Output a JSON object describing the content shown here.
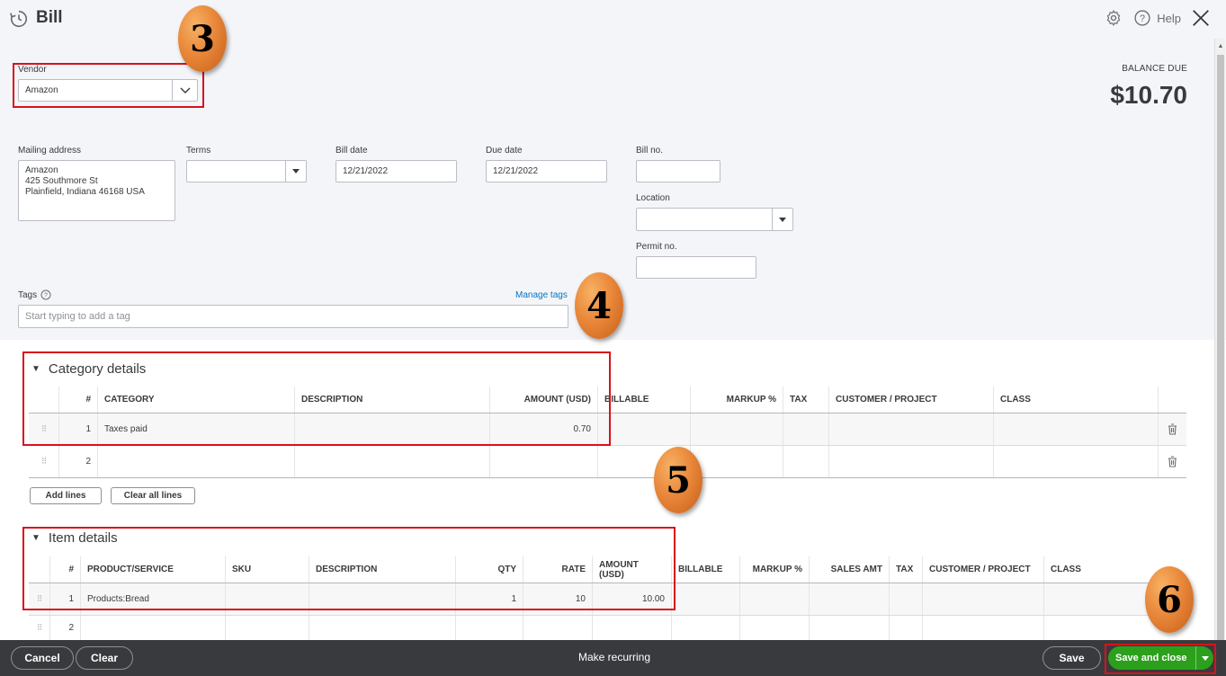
{
  "header": {
    "title": "Bill",
    "help_label": "Help",
    "balance_label": "BALANCE DUE",
    "balance_value": "$10.70"
  },
  "form": {
    "vendor_label": "Vendor",
    "vendor_value": "Amazon",
    "mailing_label": "Mailing address",
    "mailing_lines": [
      "Amazon",
      "425 Southmore St",
      "Plainfield, Indiana  46168 USA"
    ],
    "terms_label": "Terms",
    "terms_value": "",
    "bill_date_label": "Bill date",
    "bill_date_value": "12/21/2022",
    "due_date_label": "Due date",
    "due_date_value": "12/21/2022",
    "bill_no_label": "Bill no.",
    "bill_no_value": "",
    "location_label": "Location",
    "location_value": "",
    "permit_label": "Permit no.",
    "permit_value": "",
    "tags_label": "Tags",
    "manage_tags": "Manage tags",
    "tags_placeholder": "Start typing to add a tag"
  },
  "category": {
    "title": "Category details",
    "headers": [
      "#",
      "CATEGORY",
      "DESCRIPTION",
      "AMOUNT (USD)",
      "BILLABLE",
      "MARKUP %",
      "TAX",
      "CUSTOMER / PROJECT",
      "CLASS"
    ],
    "rows": [
      {
        "num": "1",
        "category": "Taxes paid",
        "description": "",
        "amount": "0.70"
      },
      {
        "num": "2",
        "category": "",
        "description": "",
        "amount": ""
      }
    ],
    "add_lines": "Add lines",
    "clear_lines": "Clear all lines"
  },
  "items": {
    "title": "Item details",
    "headers": [
      "#",
      "PRODUCT/SERVICE",
      "SKU",
      "DESCRIPTION",
      "QTY",
      "RATE",
      "AMOUNT (USD)",
      "BILLABLE",
      "MARKUP %",
      "SALES AMT",
      "TAX",
      "CUSTOMER / PROJECT",
      "CLASS"
    ],
    "rows": [
      {
        "num": "1",
        "product": "Products:Bread",
        "sku": "",
        "description": "",
        "qty": "1",
        "rate": "10",
        "amount": "10.00"
      },
      {
        "num": "2",
        "product": "",
        "sku": "",
        "description": "",
        "qty": "",
        "rate": "",
        "amount": ""
      }
    ]
  },
  "footer": {
    "cancel": "Cancel",
    "clear": "Clear",
    "make_recurring": "Make recurring",
    "save": "Save",
    "save_and_close": "Save and close"
  },
  "callouts": [
    "3",
    "4",
    "5",
    "6"
  ],
  "colors": {
    "accent_green": "#2ca01c",
    "link_blue": "#0077c5",
    "highlight_red": "#d9121b",
    "callout_orange": "#e9873a",
    "footer_bg": "#393a3d"
  }
}
